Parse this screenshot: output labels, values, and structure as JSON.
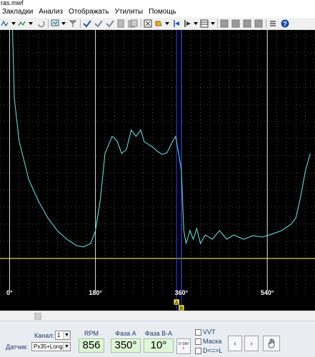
{
  "window": {
    "title": "ras.mwf"
  },
  "menu": [
    {
      "label": "Закладки"
    },
    {
      "label": "Анализ"
    },
    {
      "label": "Отображать"
    },
    {
      "label": "Утилиты"
    },
    {
      "label": "Помощь"
    }
  ],
  "toolbar": {
    "icons": [
      "channel-wave-icon",
      "channel-wave-2-icon",
      "undo-arrow-icon",
      "display-monitor-icon",
      "cursor-icon",
      "check-icon",
      "check-double-icon",
      "check-triple-icon",
      "page-icon",
      "pages-icon",
      "zoom-box-icon",
      "fill-icon",
      "folder-open-icon",
      "marker-a-icon",
      "marker-b-icon",
      "grid-view-icon",
      "list-view-icon",
      "gray-box-icon",
      "gray-box-2-icon",
      "gray-box-3-icon",
      "gray-box-4-icon",
      "help-icon"
    ]
  },
  "scope": {
    "background": "#000000",
    "trace_color": "#5ed7d7",
    "grid_color": "#8a8a8a",
    "major_line_color": "#ffffff",
    "cursor_color": "#3a3aff",
    "level_line_color": "#ffff66",
    "markers": {
      "a": "A",
      "b": "B"
    }
  },
  "chart_data": {
    "type": "line",
    "x_unit": "deg",
    "xlim": [
      -20,
      640
    ],
    "tick_labels": [
      "0°",
      "180°",
      "360°",
      "540°"
    ],
    "tick_values": [
      0,
      180,
      360,
      540
    ],
    "cursors_deg": [
      350,
      360
    ],
    "series": [
      {
        "values": [
          [
            5,
            460
          ],
          [
            10,
            250
          ],
          [
            20,
            150
          ],
          [
            40,
            60
          ],
          [
            60,
            10
          ],
          [
            80,
            -30
          ],
          [
            100,
            -60
          ],
          [
            120,
            -80
          ],
          [
            140,
            -95
          ],
          [
            155,
            -98
          ],
          [
            170,
            -90
          ],
          [
            180,
            -60
          ],
          [
            190,
            10
          ],
          [
            200,
            120
          ],
          [
            215,
            160
          ],
          [
            225,
            150
          ],
          [
            235,
            120
          ],
          [
            245,
            130
          ],
          [
            255,
            175
          ],
          [
            265,
            160
          ],
          [
            275,
            175
          ],
          [
            282,
            148
          ],
          [
            290,
            142
          ],
          [
            300,
            135
          ],
          [
            310,
            125
          ],
          [
            320,
            118
          ],
          [
            330,
            122
          ],
          [
            340,
            145
          ],
          [
            348,
            160
          ],
          [
            355,
            115
          ],
          [
            360,
            80
          ],
          [
            365,
            -60
          ],
          [
            370,
            -90
          ],
          [
            378,
            -60
          ],
          [
            385,
            -80
          ],
          [
            392,
            -55
          ],
          [
            400,
            -90
          ],
          [
            410,
            -70
          ],
          [
            425,
            -80
          ],
          [
            440,
            -60
          ],
          [
            455,
            -80
          ],
          [
            470,
            -70
          ],
          [
            490,
            -80
          ],
          [
            510,
            -72
          ],
          [
            530,
            -75
          ],
          [
            550,
            -68
          ],
          [
            570,
            -60
          ],
          [
            590,
            -45
          ],
          [
            600,
            -30
          ],
          [
            610,
            20
          ],
          [
            620,
            80
          ],
          [
            630,
            120
          ]
        ]
      }
    ]
  },
  "bottom_panel": {
    "channel_label": "Канал:",
    "channel_value": "1",
    "sensor_label": "Датчик:",
    "sensor_value": "Px35+Long",
    "rpm_title": "RPM",
    "rpm_value": "856",
    "phase_a_title": "Фаза A",
    "phase_a_value": "350°",
    "phase_ba_title": "Фаза B-A",
    "phase_ba_value": "10°",
    "dsl_button": "D SMI L",
    "chk_vvt": "VVT",
    "chk_mask": "Маска",
    "chk_dl": "D<=>L",
    "prev_button": "‹",
    "next_button": "›",
    "hand_icon": "hand-icon"
  }
}
